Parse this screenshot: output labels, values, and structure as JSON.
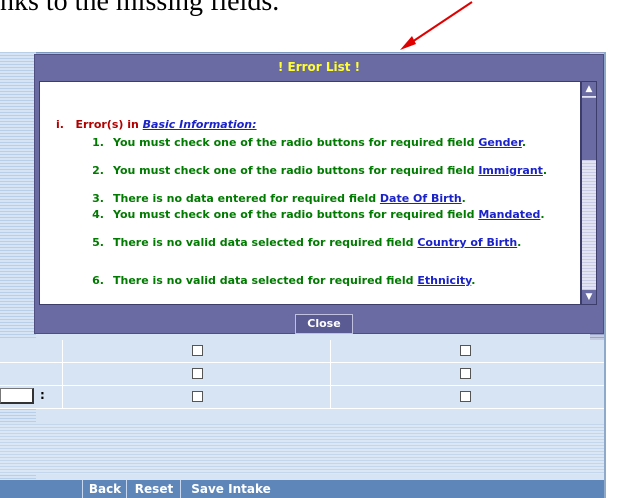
{
  "document": {
    "top_text": "nks to the missing fields."
  },
  "dialog": {
    "title": "! Error List !",
    "section_numeral": "i.",
    "section_prefix": "Error(s) in ",
    "section_link": "Basic Information:",
    "close_label": "Close",
    "errors": [
      {
        "num": "1.",
        "text": "You must check one of the radio buttons for required field ",
        "field": "Gender",
        "suffix": "."
      },
      {
        "num": "2.",
        "text": "You must check one of the radio buttons for required field ",
        "field": "Immigrant",
        "suffix": "."
      },
      {
        "num": "3.",
        "text": "There is no data entered for required field ",
        "field": "Date Of Birth",
        "suffix": "."
      },
      {
        "num": "4.",
        "text": "You must check one of the radio buttons for required field ",
        "field": "Mandated",
        "suffix": "."
      },
      {
        "num": "5.",
        "text": "There is no valid data selected for required field ",
        "field": "Country of Birth",
        "suffix": "."
      },
      {
        "num": "6.",
        "text": "There is no valid data selected for required field ",
        "field": "Ethnicity",
        "suffix": "."
      }
    ]
  },
  "form": {
    "colon": ":",
    "buttons": {
      "back": "Back",
      "reset": "Reset",
      "save": "Save Intake"
    }
  },
  "colors": {
    "dialog_bg": "#6a6ba2",
    "title_text": "#ffff33",
    "error_red": "#b00000",
    "item_green": "#007a00",
    "link_blue": "#1a22c8"
  }
}
